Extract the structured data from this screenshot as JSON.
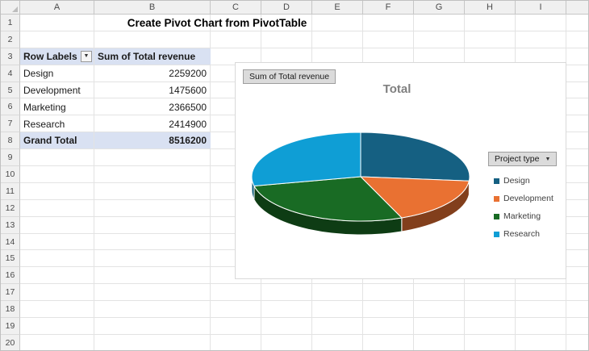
{
  "sheet": {
    "columns": [
      "A",
      "B",
      "C",
      "D",
      "E",
      "F",
      "G",
      "H",
      "I"
    ],
    "rows": [
      "1",
      "2",
      "3",
      "4",
      "5",
      "6",
      "7",
      "8",
      "9",
      "10",
      "11",
      "12",
      "13",
      "14",
      "15",
      "16",
      "17",
      "18",
      "19",
      "20"
    ],
    "title": "Create Pivot Chart from PivotTable"
  },
  "pivot": {
    "header": {
      "row_labels": "Row Labels",
      "value_label": "Sum of Total revenue"
    },
    "rows": [
      {
        "label": "Design",
        "value": "2259200"
      },
      {
        "label": "Development",
        "value": "1475600"
      },
      {
        "label": "Marketing",
        "value": "2366500"
      },
      {
        "label": "Research",
        "value": "2414900"
      }
    ],
    "grand_total": {
      "label": "Grand Total",
      "value": "8516200"
    }
  },
  "chart": {
    "value_field_button": "Sum of Total revenue",
    "title": "Total",
    "filter_field_button": "Project type",
    "legend": [
      {
        "label": "Design",
        "color": "#156082"
      },
      {
        "label": "Development",
        "color": "#E97132"
      },
      {
        "label": "Marketing",
        "color": "#196B24"
      },
      {
        "label": "Research",
        "color": "#0F9ED5"
      }
    ]
  },
  "chart_data": {
    "type": "pie",
    "style": "3d",
    "title": "Total",
    "categories": [
      "Design",
      "Development",
      "Marketing",
      "Research"
    ],
    "values": [
      2259200,
      1475600,
      2366500,
      2414900
    ],
    "total": 8516200,
    "colors": [
      "#156082",
      "#E97132",
      "#196B24",
      "#0F9ED5"
    ],
    "legend_position": "right",
    "start_angle_deg": 0
  }
}
